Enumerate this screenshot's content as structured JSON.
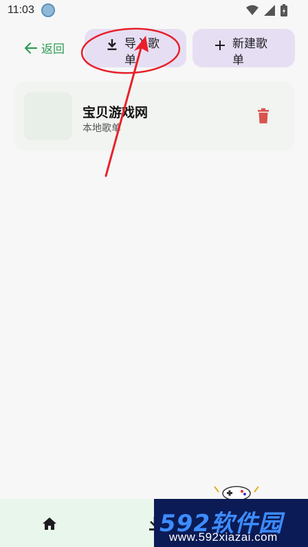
{
  "status_bar": {
    "time": "11:03"
  },
  "top_bar": {
    "back_label": "返回",
    "import_label": "导入歌单",
    "new_label": "新建歌单"
  },
  "playlists": [
    {
      "title": "宝贝游戏网",
      "subtitle": "本地歌单"
    }
  ],
  "watermark": {
    "brand": "592软件园",
    "url": "www.592xiazai.com"
  },
  "colors": {
    "accent_green": "#2e9d57",
    "pill_bg": "#e6dff3",
    "delete_red": "#d9534f",
    "annotation_red": "#e8202a",
    "nav_bg": "#e9f6ec"
  },
  "icons": [
    "back-arrow-icon",
    "download-icon",
    "plus-icon",
    "trash-icon",
    "home-icon",
    "wifi-icon",
    "signal-icon",
    "battery-icon"
  ]
}
